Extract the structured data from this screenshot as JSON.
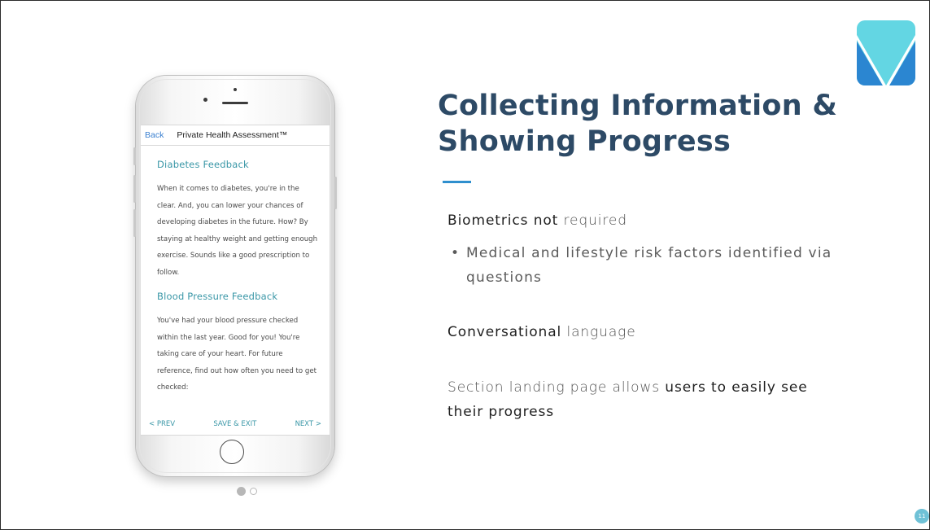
{
  "colors": {
    "title": "#2d4a66",
    "accent": "#2f8fce",
    "teal": "#3a97a7",
    "link_blue": "#3b80d0",
    "logo_light": "#63d6e3",
    "logo_dark": "#2b86d1",
    "badge": "#6fc1d6"
  },
  "logo": {
    "icon": "v-logo-icon"
  },
  "phone": {
    "nav": {
      "back_label": "Back",
      "title": "Private Health Assessment™"
    },
    "sections": [
      {
        "title": "Diabetes Feedback",
        "text": "When it comes to diabetes, you're in the clear. And, you can lower your chances of developing diabetes in the future. How? By staying at healthy weight and getting enough exercise. Sounds like a good prescription to follow."
      },
      {
        "title": "Blood Pressure Feedback",
        "text": "You've had your blood pressure checked within the last year. Good for you! You're taking care of your heart. For future reference, find out how often you need to get checked:"
      }
    ],
    "bottom_bar": {
      "prev": "< PREV",
      "save_exit": "SAVE & EXIT",
      "next": "NEXT >"
    }
  },
  "carousel": {
    "total": 2,
    "active_index": 0
  },
  "slide": {
    "title_line1": "Collecting Information &",
    "title_line2": "Showing Progress",
    "point1": {
      "strong": "Biometrics not",
      "rest": " required"
    },
    "point1_bullet": "Medical and lifestyle risk factors identified via questions",
    "point2": {
      "strong": "Conversational",
      "rest": " language"
    },
    "point3": {
      "lead": "Section landing page allows ",
      "strong1": "users to easily see",
      "strong2": "their progress"
    },
    "page_number": "11"
  }
}
